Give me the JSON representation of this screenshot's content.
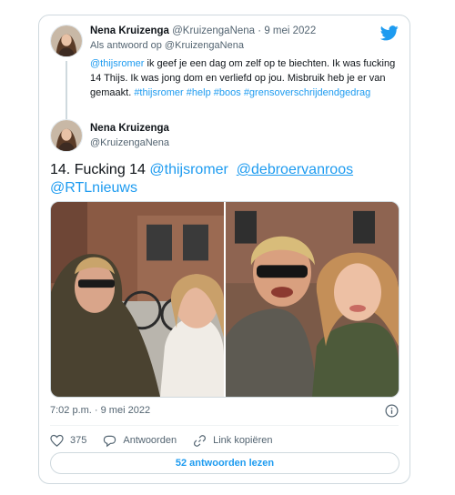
{
  "reply": {
    "name": "Nena Kruizenga",
    "handle": "@KruizengaNena",
    "separator": "·",
    "date": "9 mei 2022",
    "reply_to": "Als antwoord op @KruizengaNena",
    "mention": "@thijsromer",
    "text_part": " ik geef je een dag om zelf op te biechten. Ik was fucking 14 Thijs. Ik was jong dom en verliefd op jou. Misbruik heb je er van gemaakt. ",
    "hashtags": [
      "#thijsromer",
      "#help",
      "#boos",
      "#grensoverschrijdendgedrag"
    ]
  },
  "tweet": {
    "name": "Nena Kruizenga",
    "handle": "@KruizengaNena",
    "text_start": "14. Fucking 14 ",
    "mentions": [
      "@thijsromer",
      "@debroervanroos",
      "@RTLnieuws"
    ],
    "timestamp": "7:02 p.m. · 9 mei 2022"
  },
  "actions": {
    "likes": "375",
    "reply_label": "Antwoorden",
    "copy_link_label": "Link kopiëren"
  },
  "read_replies_label": "52 antwoorden lezen",
  "colors": {
    "accent": "#1d9bf0",
    "text": "#0f1419",
    "muted": "#536471",
    "border": "#cfd9de"
  },
  "icons": [
    "twitter-bird-icon",
    "heart-icon",
    "reply-icon",
    "link-icon",
    "info-icon"
  ]
}
